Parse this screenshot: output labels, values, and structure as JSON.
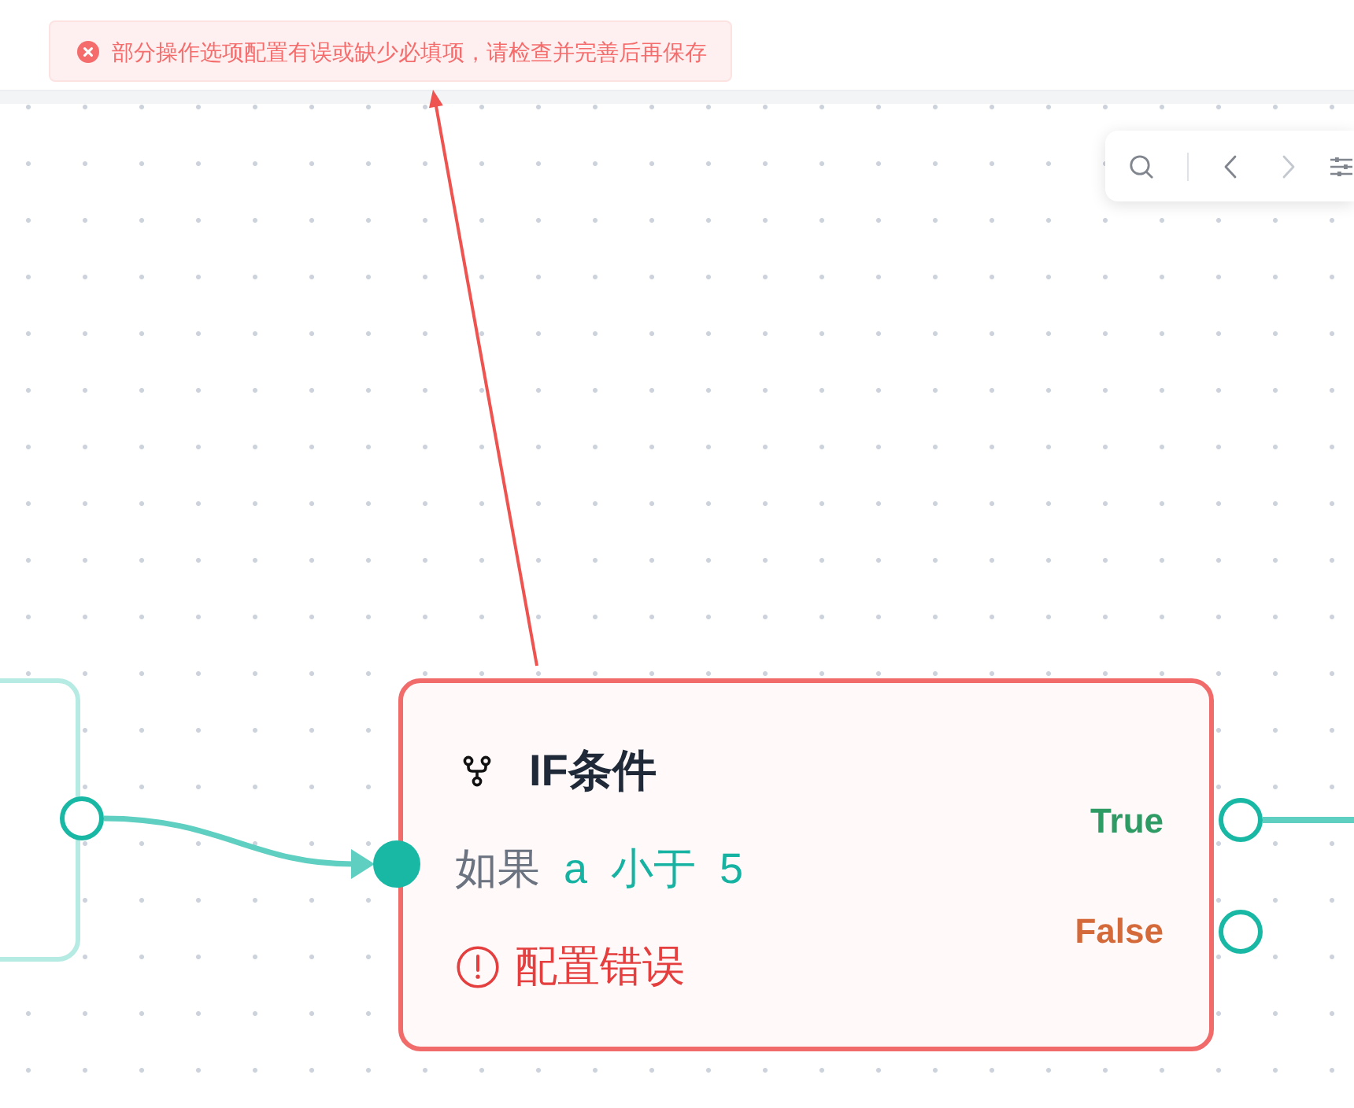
{
  "toast": {
    "kind": "error",
    "message": "部分操作选项配置有误或缺少必填项，请检查并完善后再保存"
  },
  "toolbar": {
    "tools": [
      {
        "kind": "search",
        "disabled": false
      },
      {
        "kind": "previous",
        "disabled": false
      },
      {
        "kind": "next",
        "disabled": true
      },
      {
        "kind": "settings",
        "disabled": false
      }
    ]
  },
  "nodes": [
    {
      "kind": "start",
      "invalid": false,
      "output_connected": true
    },
    {
      "kind": "condition",
      "invalid": true,
      "title": "IF条件",
      "condition": [
        {
          "kind": "keyword",
          "text": "如果"
        },
        {
          "kind": "value",
          "text": "a"
        },
        {
          "kind": "value",
          "text": "小于"
        },
        {
          "kind": "value",
          "text": "5"
        }
      ],
      "error": "配置错误",
      "branches": [
        {
          "label": "True",
          "color": "#2e9b65",
          "connected": true
        },
        {
          "label": "False",
          "color": "#d4693a",
          "connected": false
        }
      ]
    }
  ]
}
